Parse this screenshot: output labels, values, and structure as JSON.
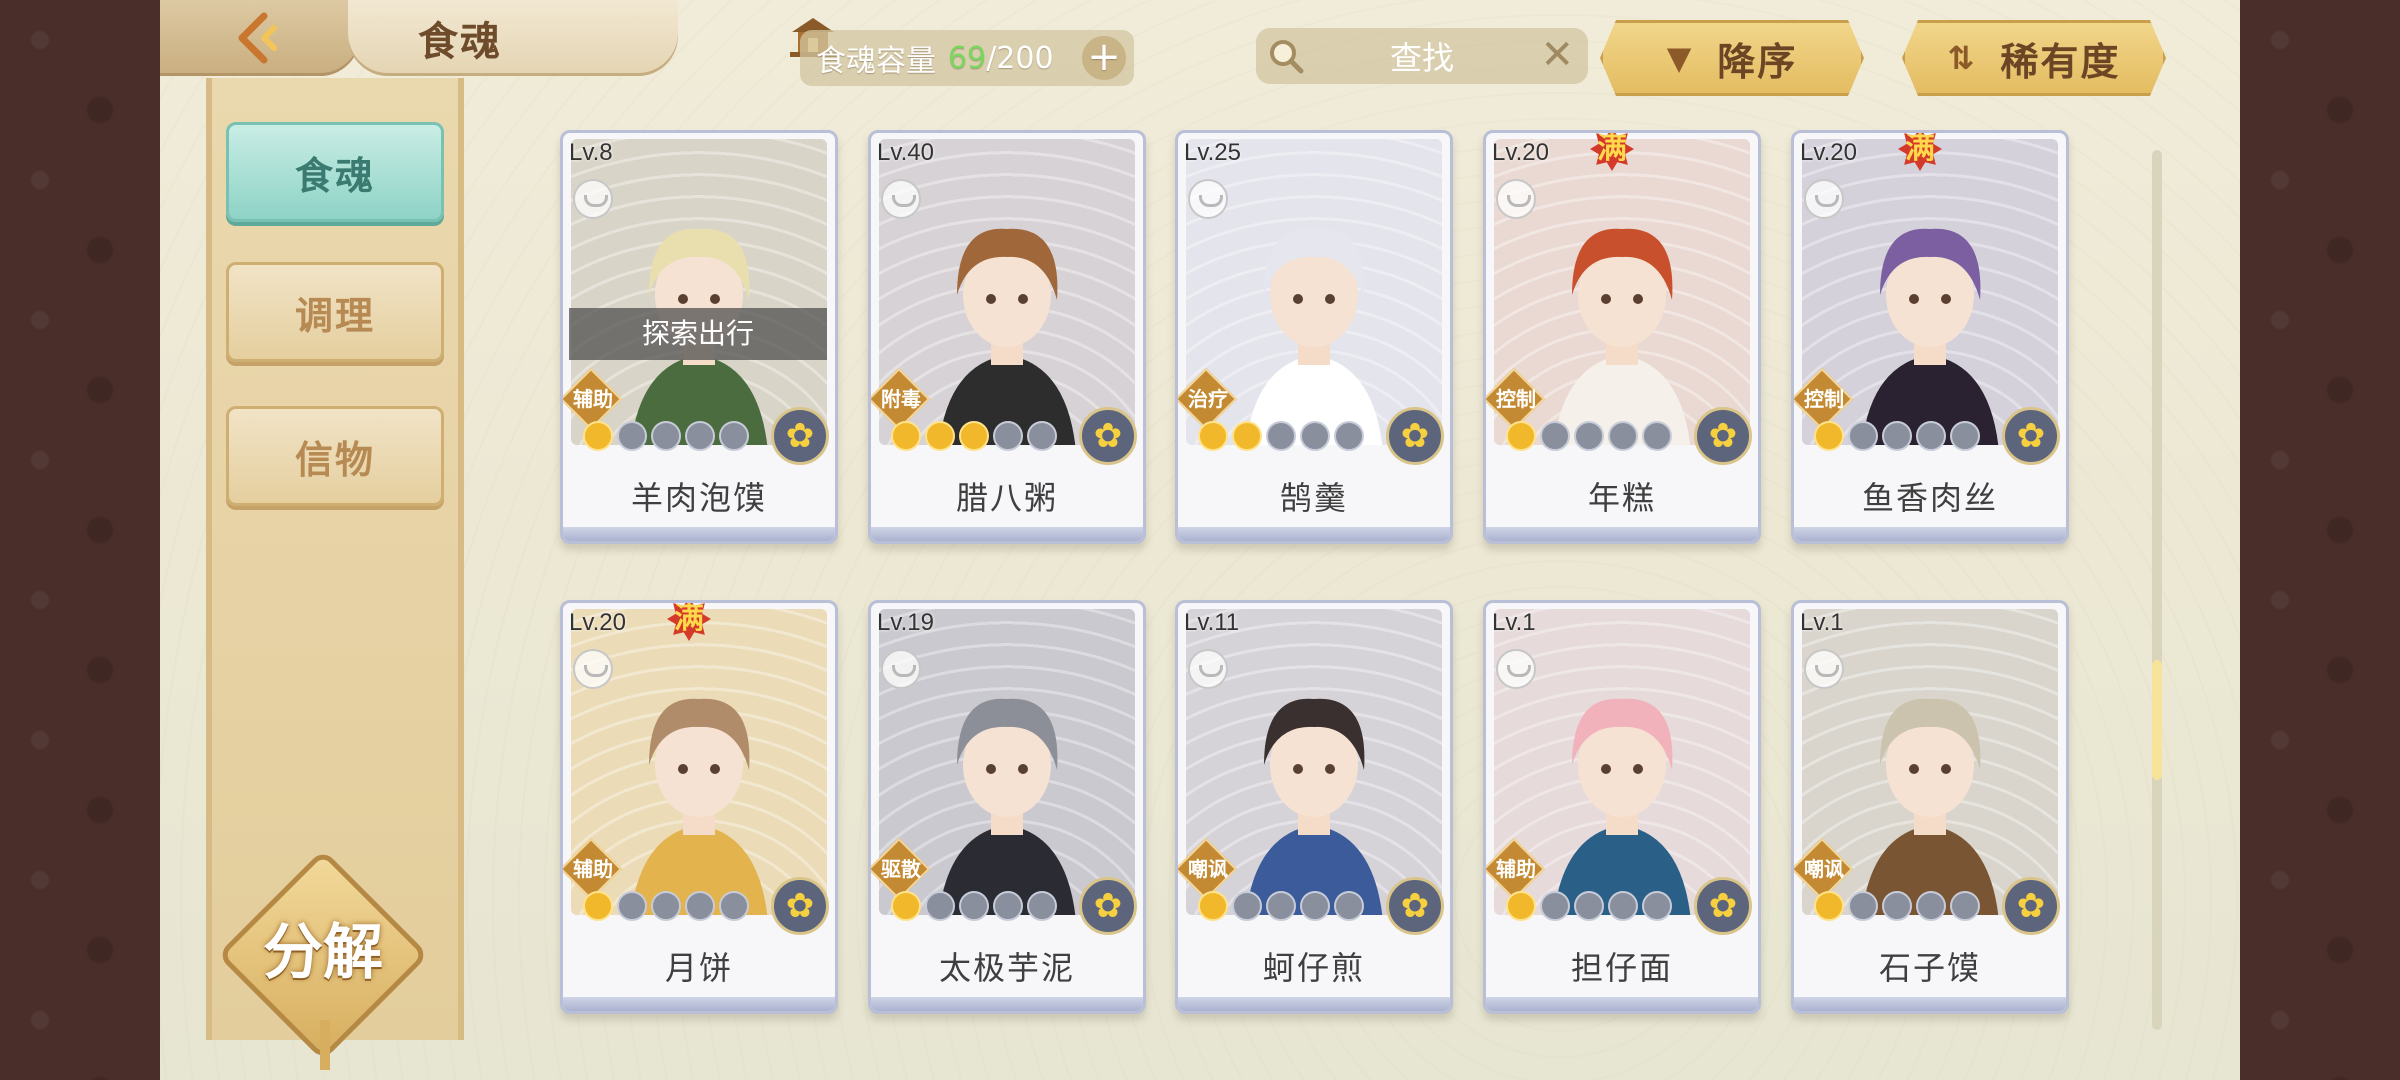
{
  "header": {
    "title": "食魂",
    "capacity_label": "食魂容量",
    "capacity_current": "69",
    "capacity_max": "/200",
    "search_label": "查找",
    "sort_order_label": "降序",
    "sort_field_label": "稀有度"
  },
  "sidebar": {
    "items": [
      {
        "label": "食魂"
      },
      {
        "label": "调理"
      },
      {
        "label": "信物"
      }
    ],
    "decompose_label": "分解"
  },
  "cards": [
    {
      "level": "Lv.8",
      "name": "羊肉泡馍",
      "role": "辅助",
      "stars": 1,
      "status": "探索出行",
      "full": "",
      "bg": "#d9d4c8",
      "hair": "#e9dfae",
      "outfit": "#4b6c3e"
    },
    {
      "level": "Lv.40",
      "name": "腊八粥",
      "role": "附毒",
      "stars": 3,
      "status": "",
      "full": "",
      "bg": "#d7d2d6",
      "hair": "#a0683a",
      "outfit": "#2d2d2d"
    },
    {
      "level": "Lv.25",
      "name": "鹄羹",
      "role": "治疗",
      "stars": 2,
      "status": "",
      "full": "",
      "bg": "#e3e4ec",
      "hair": "#e6e6ef",
      "outfit": "#ffffff"
    },
    {
      "level": "Lv.20",
      "name": "年糕",
      "role": "控制",
      "stars": 1,
      "status": "",
      "full": "满",
      "bg": "#e9d9d2",
      "hair": "#c9502c",
      "outfit": "#f5f0ea"
    },
    {
      "level": "Lv.20",
      "name": "鱼香肉丝",
      "role": "控制",
      "stars": 1,
      "status": "",
      "full": "满",
      "bg": "#d4d1da",
      "hair": "#7b5fa0",
      "outfit": "#2a2230"
    },
    {
      "level": "Lv.20",
      "name": "月饼",
      "role": "辅助",
      "stars": 1,
      "status": "",
      "full": "满",
      "bg": "#ebdcb7",
      "hair": "#b08c6a",
      "outfit": "#e3b44d"
    },
    {
      "level": "Lv.19",
      "name": "太极芋泥",
      "role": "驱散",
      "stars": 1,
      "status": "",
      "full": "",
      "bg": "#c9c9cf",
      "hair": "#8c8f98",
      "outfit": "#2b2b33"
    },
    {
      "level": "Lv.11",
      "name": "蚵仔煎",
      "role": "嘲讽",
      "stars": 1,
      "status": "",
      "full": "",
      "bg": "#d6d3d8",
      "hair": "#3a3030",
      "outfit": "#3b5b9a"
    },
    {
      "level": "Lv.1",
      "name": "担仔面",
      "role": "辅助",
      "stars": 1,
      "status": "",
      "full": "",
      "bg": "#e6dada",
      "hair": "#f1b2bb",
      "outfit": "#2a5f87"
    },
    {
      "level": "Lv.1",
      "name": "石子馍",
      "role": "嘲讽",
      "stars": 1,
      "status": "",
      "full": "",
      "bg": "#d9d5cc",
      "hair": "#cbc3ae",
      "outfit": "#7a5533"
    }
  ]
}
